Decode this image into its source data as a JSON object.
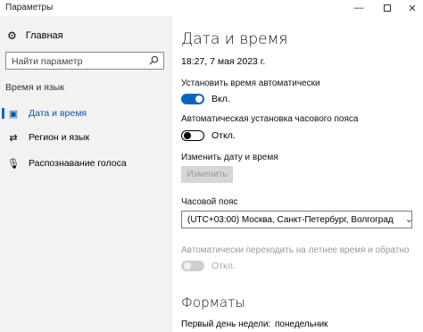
{
  "window": {
    "title": "Параметры"
  },
  "sidebar": {
    "home_label": "Главная",
    "search_placeholder": "Найти параметр",
    "section_title": "Время и язык",
    "items": [
      {
        "label": "Дата и время",
        "icon": "calendar-icon",
        "active": true
      },
      {
        "label": "Регион и язык",
        "icon": "region-icon",
        "active": false
      },
      {
        "label": "Распознавание голоса",
        "icon": "microphone-icon",
        "active": false
      }
    ]
  },
  "main": {
    "title": "Дата и время",
    "current_datetime": "18:27, 7 мая 2023 г.",
    "auto_time": {
      "label": "Установить время автоматически",
      "state": "Вкл."
    },
    "auto_timezone": {
      "label": "Автоматическая установка часового пояса",
      "state": "Откл."
    },
    "change_datetime": {
      "label": "Изменить дату и время",
      "button": "Изменить"
    },
    "timezone": {
      "label": "Часовой пояс",
      "value": "(UTC+03:00) Москва, Санкт-Петербург, Волгоград"
    },
    "dst": {
      "label": "Автоматически переходить на летнее время и обратно",
      "state": "Откл."
    },
    "formats": {
      "title": "Форматы",
      "first_day_label": "Первый день недели:",
      "first_day_value": "понедельник"
    }
  },
  "colors": {
    "accent": "#0067c0",
    "sidebar_bg": "#f2f2f2",
    "disabled": "#d6d6d6"
  }
}
